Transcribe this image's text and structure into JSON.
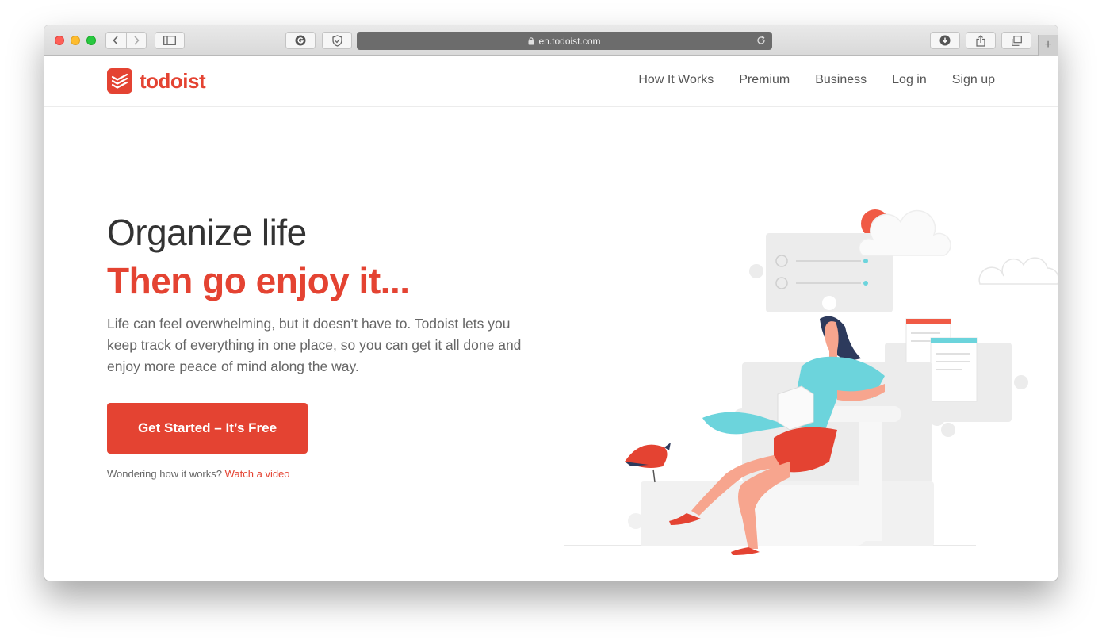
{
  "browser": {
    "url": "en.todoist.com",
    "icons": [
      "back-arrow-icon",
      "forward-arrow-icon",
      "sidebar-icon",
      "grammarly-icon",
      "shield-icon",
      "lock-icon",
      "reload-icon",
      "download-icon",
      "share-icon",
      "tabs-icon",
      "plus-icon"
    ],
    "new_tab_label": "+"
  },
  "brand": {
    "name": "todoist",
    "color": "#e44332"
  },
  "nav": {
    "items": [
      "How It Works",
      "Premium",
      "Business",
      "Log in",
      "Sign up"
    ]
  },
  "hero": {
    "title": "Organize life",
    "subtitle": "Then go enjoy it...",
    "description": "Life can feel overwhelming, but it doesn’t have to. Todoist lets you keep track of everything in one place, so you can get it all done and enjoy more peace of mind along the way.",
    "cta_label": "Get Started – It’s Free",
    "helper_text": "Wondering how it works?",
    "helper_link": "Watch a video"
  },
  "colors": {
    "accent": "#e44332",
    "teal": "#6cd4dc",
    "skin": "#f7a58e",
    "hair": "#2d3a5c",
    "puzzle": "#ececec"
  }
}
